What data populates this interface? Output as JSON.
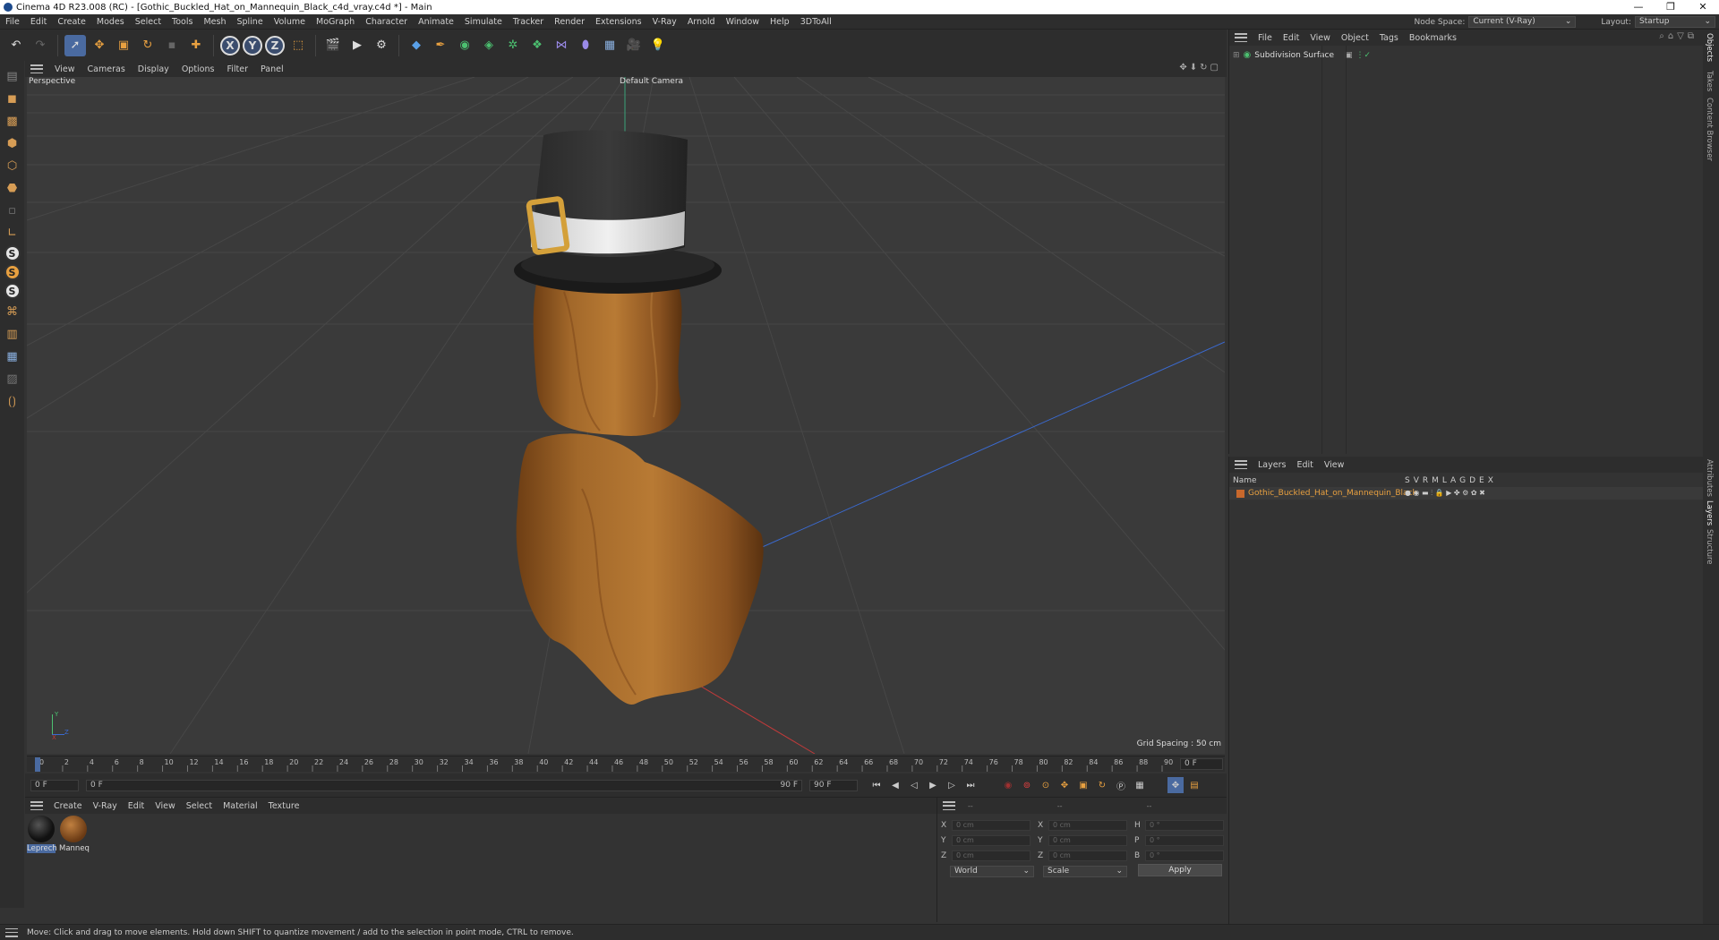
{
  "window": {
    "title": "Cinema 4D R23.008 (RC) - [Gothic_Buckled_Hat_on_Mannequin_Black_c4d_vray.c4d *] - Main",
    "controls": [
      "—",
      "❐",
      "✕"
    ]
  },
  "menubar": {
    "items": [
      "File",
      "Edit",
      "Create",
      "Modes",
      "Select",
      "Tools",
      "Mesh",
      "Spline",
      "Volume",
      "MoGraph",
      "Character",
      "Animate",
      "Simulate",
      "Tracker",
      "Render",
      "Extensions",
      "V-Ray",
      "Arnold",
      "Window",
      "Help",
      "3DToAll"
    ],
    "node_space_label": "Node Space:",
    "node_space_value": "Current (V-Ray)",
    "layout_label": "Layout:",
    "layout_value": "Startup"
  },
  "toolbar": {
    "icons": [
      "undo-icon",
      "redo-icon",
      "live-selection-icon",
      "move-icon",
      "scale-icon",
      "rotate-icon",
      "last-tool-icon",
      "world-add-icon",
      "x-axis-icon",
      "y-axis-icon",
      "z-axis-icon",
      "coordinate-system-icon",
      "render-region-icon",
      "render-view-icon",
      "render-settings-icon",
      "cube-icon",
      "pen-icon",
      "subdivision-icon",
      "extrude-icon",
      "cloner-icon",
      "mograph-icon",
      "deformer-icon",
      "field-icon",
      "floor-icon",
      "camera-icon",
      "light-icon"
    ],
    "axis_labels": [
      "X",
      "Y",
      "Z"
    ]
  },
  "viewport": {
    "menu": [
      "View",
      "Cameras",
      "Display",
      "Options",
      "Filter",
      "Panel"
    ],
    "view_name": "Perspective",
    "camera_name": "Default Camera",
    "grid_spacing": "Grid Spacing : 50 cm",
    "axis_labels": [
      "Y",
      "Z",
      "X"
    ]
  },
  "timeline": {
    "ticks": [
      "0",
      "2",
      "4",
      "6",
      "8",
      "10",
      "12",
      "14",
      "16",
      "18",
      "20",
      "22",
      "24",
      "26",
      "28",
      "30",
      "32",
      "34",
      "36",
      "38",
      "40",
      "42",
      "44",
      "46",
      "48",
      "50",
      "52",
      "54",
      "56",
      "58",
      "60",
      "62",
      "64",
      "66",
      "68",
      "70",
      "72",
      "74",
      "76",
      "78",
      "80",
      "82",
      "84",
      "86",
      "88",
      "90"
    ],
    "end_frame_field": "0 F",
    "current_frame": "0 F",
    "start_frame": "0 F",
    "end_frame": "90 F",
    "end_frame2": "90 F"
  },
  "material_manager": {
    "menu": [
      "Create",
      "V-Ray",
      "Edit",
      "View",
      "Select",
      "Material",
      "Texture"
    ],
    "materials": [
      {
        "name": "Leprech",
        "color": "#1a1a1a"
      },
      {
        "name": "Manneq",
        "color": "#8a5424"
      }
    ]
  },
  "coordinates": {
    "header_dashes": [
      "--",
      "--",
      "--"
    ],
    "rows": [
      {
        "a": "X",
        "av": "0 cm",
        "b": "X",
        "bv": "0 cm",
        "c": "H",
        "cv": "0 °"
      },
      {
        "a": "Y",
        "av": "0 cm",
        "b": "Y",
        "bv": "0 cm",
        "c": "P",
        "cv": "0 °"
      },
      {
        "a": "Z",
        "av": "0 cm",
        "b": "Z",
        "bv": "0 cm",
        "c": "B",
        "cv": "0 °"
      }
    ],
    "mode": "World",
    "scale": "Scale",
    "apply": "Apply"
  },
  "objects_panel": {
    "menu": [
      "File",
      "Edit",
      "View",
      "Object",
      "Tags",
      "Bookmarks"
    ],
    "object_name": "Subdivision Surface"
  },
  "layers_panel": {
    "menu": [
      "Layers",
      "Edit",
      "View"
    ],
    "name_header": "Name",
    "flags": [
      "S",
      "V",
      "R",
      "M",
      "L",
      "A",
      "G",
      "D",
      "E",
      "X"
    ],
    "layer_name": "Gothic_Buckled_Hat_on_Mannequin_Black",
    "layer_color": "#c8682c"
  },
  "side_tabs_top": [
    "Objects",
    "Takes",
    "Content Browser"
  ],
  "side_tabs_bottom": [
    "Attributes",
    "Layers",
    "Structure"
  ],
  "status": {
    "text": "Move: Click and drag to move elements. Hold down SHIFT to quantize movement / add to the selection in point mode, CTRL to remove."
  },
  "colors": {
    "accent": "#4a6aa0",
    "ui_bg": "#333333",
    "viewport_bg": "#3a3a3a",
    "wood": "#9a5f24",
    "hat": "#1e1e1e",
    "band": "#e0e0e0",
    "buckle": "#d4a03a"
  }
}
